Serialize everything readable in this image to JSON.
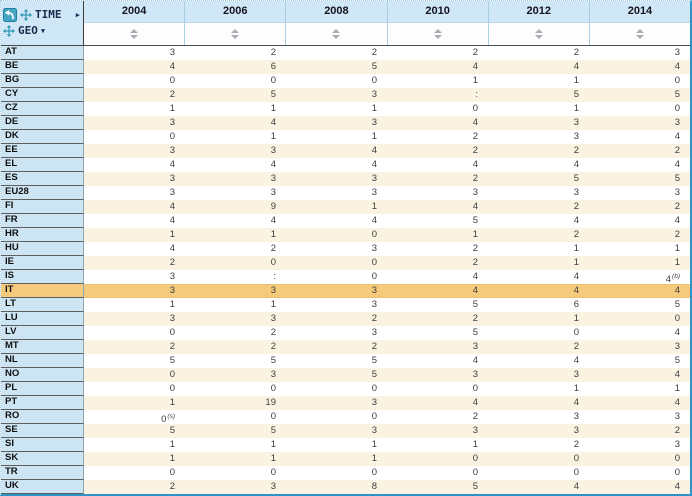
{
  "table": {
    "row_axis_label": "TIME",
    "col_axis_label": "GEO",
    "time_arrow_glyph": "▶",
    "geo_arrow_glyph": "▼",
    "columns": [
      "2004",
      "2006",
      "2008",
      "2010",
      "2012",
      "2014"
    ],
    "rows": [
      {
        "geo": "AT",
        "values": [
          "3",
          "2",
          "2",
          "2",
          "2",
          "3"
        ]
      },
      {
        "geo": "BE",
        "values": [
          "4",
          "6",
          "5",
          "4",
          "4",
          "4"
        ]
      },
      {
        "geo": "BG",
        "values": [
          "0",
          "0",
          "0",
          "1",
          "1",
          "0"
        ]
      },
      {
        "geo": "CY",
        "values": [
          "2",
          "5",
          "3",
          ":",
          "5",
          "5"
        ]
      },
      {
        "geo": "CZ",
        "values": [
          "1",
          "1",
          "1",
          "0",
          "1",
          "0"
        ]
      },
      {
        "geo": "DE",
        "values": [
          "3",
          "4",
          "3",
          "4",
          "3",
          "3"
        ]
      },
      {
        "geo": "DK",
        "values": [
          "0",
          "1",
          "1",
          "2",
          "3",
          "4"
        ]
      },
      {
        "geo": "EE",
        "values": [
          "3",
          "3",
          "4",
          "2",
          "2",
          "2"
        ]
      },
      {
        "geo": "EL",
        "values": [
          "4",
          "4",
          "4",
          "4",
          "4",
          "4"
        ]
      },
      {
        "geo": "ES",
        "values": [
          "3",
          "3",
          "3",
          "2",
          "5",
          "5"
        ]
      },
      {
        "geo": "EU28",
        "values": [
          "3",
          "3",
          "3",
          "3",
          "3",
          "3"
        ]
      },
      {
        "geo": "FI",
        "values": [
          "4",
          "9",
          "1",
          "4",
          "2",
          "2"
        ]
      },
      {
        "geo": "FR",
        "values": [
          "4",
          "4",
          "4",
          "5",
          "4",
          "4"
        ]
      },
      {
        "geo": "HR",
        "values": [
          "1",
          "1",
          "0",
          "1",
          "2",
          "2"
        ]
      },
      {
        "geo": "HU",
        "values": [
          "4",
          "2",
          "3",
          "2",
          "1",
          "1"
        ]
      },
      {
        "geo": "IE",
        "values": [
          "2",
          "0",
          "0",
          "2",
          "1",
          "1"
        ]
      },
      {
        "geo": "IS",
        "values": [
          "3",
          ":",
          "0",
          "4",
          "4",
          {
            "v": "4",
            "flag": "(b)"
          }
        ]
      },
      {
        "geo": "IT",
        "highlighted": true,
        "values": [
          "3",
          "3",
          "3",
          "4",
          "4",
          "4"
        ]
      },
      {
        "geo": "LT",
        "values": [
          "1",
          "1",
          "3",
          "5",
          "6",
          "5"
        ]
      },
      {
        "geo": "LU",
        "values": [
          "3",
          "3",
          "2",
          "2",
          "1",
          "0"
        ]
      },
      {
        "geo": "LV",
        "values": [
          "0",
          "2",
          "3",
          "5",
          "0",
          "4"
        ]
      },
      {
        "geo": "MT",
        "values": [
          "2",
          "2",
          "2",
          "3",
          "2",
          "3"
        ]
      },
      {
        "geo": "NL",
        "values": [
          "5",
          "5",
          "5",
          "4",
          "4",
          "5"
        ]
      },
      {
        "geo": "NO",
        "values": [
          "0",
          "3",
          "5",
          "3",
          "3",
          "4"
        ]
      },
      {
        "geo": "PL",
        "values": [
          "0",
          "0",
          "0",
          "0",
          "1",
          "1"
        ]
      },
      {
        "geo": "PT",
        "values": [
          "1",
          "19",
          "3",
          "4",
          "4",
          "4"
        ]
      },
      {
        "geo": "RO",
        "values": [
          {
            "v": "0",
            "flag": "(s)"
          },
          "0",
          "0",
          "2",
          "3",
          "3"
        ]
      },
      {
        "geo": "SE",
        "values": [
          "5",
          "5",
          "3",
          "3",
          "3",
          "2"
        ]
      },
      {
        "geo": "SI",
        "values": [
          "1",
          "1",
          "1",
          "1",
          "2",
          "3"
        ]
      },
      {
        "geo": "SK",
        "values": [
          "1",
          "1",
          "1",
          "0",
          "0",
          "0"
        ]
      },
      {
        "geo": "TR",
        "values": [
          "0",
          "0",
          "0",
          "0",
          "0",
          "0"
        ]
      },
      {
        "geo": "UK",
        "values": [
          "2",
          "3",
          "8",
          "5",
          "4",
          "4"
        ]
      }
    ]
  },
  "icons": {
    "pivot": "pivot-icon",
    "move": "move-icon",
    "time_arrow": "arrow-right-icon",
    "geo_arrow": "chevron-down-icon",
    "sort": "sort-icon"
  },
  "colors": {
    "header_blue": "#cfe7f6",
    "geo_blue": "#cde4f3",
    "row_cream": "#faf3e1",
    "row_white": "#ffffff",
    "highlight_orange": "#f6ca7c",
    "frame_teal": "#2e93c6",
    "icon_teal": "#2f96b4"
  }
}
